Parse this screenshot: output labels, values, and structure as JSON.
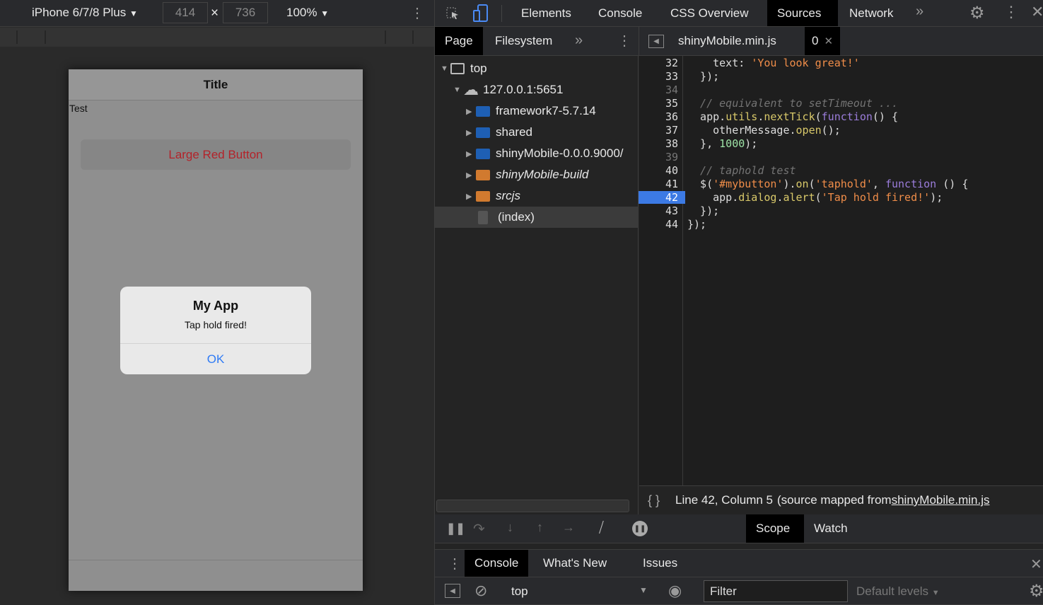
{
  "device_toolbar": {
    "device": "iPhone 6/7/8 Plus",
    "width": "414",
    "height": "736",
    "times": "×",
    "zoom": "100%"
  },
  "phone": {
    "navbar_title": "Title",
    "body_text": "Test",
    "button_label": "Large Red Button",
    "dialog": {
      "title": "My App",
      "message": "Tap hold fired!",
      "ok_label": "OK"
    }
  },
  "devtools": {
    "tabs": [
      "Elements",
      "Console",
      "CSS Overview",
      "Sources",
      "Network"
    ],
    "selected_tab": "Sources",
    "navigator_tabs": [
      "Page",
      "Filesystem"
    ],
    "tree": [
      {
        "label": "top",
        "type": "frame",
        "depth": 0,
        "expanded": true
      },
      {
        "label": "127.0.0.1:5651",
        "type": "cloud",
        "depth": 1,
        "expanded": true
      },
      {
        "label": "framework7-5.7.14",
        "type": "folder",
        "color": "#1e5fb4",
        "depth": 2
      },
      {
        "label": "shared",
        "type": "folder",
        "color": "#1e5fb4",
        "depth": 2
      },
      {
        "label": "shinyMobile-0.0.0.9000/",
        "type": "folder",
        "color": "#1e5fb4",
        "depth": 2
      },
      {
        "label": "shinyMobile-build",
        "type": "folder",
        "color": "#d17a2f",
        "depth": 2,
        "italic": true
      },
      {
        "label": "srcjs",
        "type": "folder",
        "color": "#d17a2f",
        "depth": 2,
        "italic": true
      },
      {
        "label": "(index)",
        "type": "file",
        "depth": 2,
        "selected": true
      }
    ],
    "editor_tabs": [
      {
        "label": "shinyMobile.min.js"
      },
      {
        "label": "0",
        "selected": true
      }
    ],
    "code_lines": [
      {
        "n": "32",
        "t": [
          [
            "    text: ",
            ""
          ],
          [
            "'You look great!'",
            "str"
          ]
        ]
      },
      {
        "n": "33",
        "t": [
          [
            "  });",
            ""
          ]
        ]
      },
      {
        "n": "34",
        "t": []
      },
      {
        "n": "35",
        "t": [
          [
            "  // equivalent to setTimeout ...",
            "cm"
          ]
        ]
      },
      {
        "n": "36",
        "t": [
          [
            "  app.",
            ""
          ],
          [
            "utils",
            "fn"
          ],
          [
            ".",
            ""
          ],
          [
            "nextTick",
            "fn"
          ],
          [
            "(",
            ""
          ],
          [
            "function",
            "kw"
          ],
          [
            "() {",
            ""
          ]
        ]
      },
      {
        "n": "37",
        "t": [
          [
            "    otherMessage.",
            ""
          ],
          [
            "open",
            "fn"
          ],
          [
            "();",
            ""
          ]
        ]
      },
      {
        "n": "38",
        "t": [
          [
            "  }, ",
            ""
          ],
          [
            "1000",
            "num"
          ],
          [
            ");",
            ""
          ]
        ]
      },
      {
        "n": "39",
        "t": []
      },
      {
        "n": "40",
        "t": [
          [
            "  // taphold test",
            "cm"
          ]
        ]
      },
      {
        "n": "41",
        "t": [
          [
            "  $(",
            ""
          ],
          [
            "'#mybutton'",
            "str"
          ],
          [
            ").",
            ""
          ],
          [
            "on",
            "fn"
          ],
          [
            "(",
            ""
          ],
          [
            "'taphold'",
            "str"
          ],
          [
            ", ",
            ""
          ],
          [
            "function",
            "kw"
          ],
          [
            " () {",
            ""
          ]
        ]
      },
      {
        "n": "42",
        "t": [
          [
            "    app.",
            ""
          ],
          [
            "dialog",
            "fn"
          ],
          [
            ".",
            ""
          ],
          [
            "alert",
            "fn"
          ],
          [
            "(",
            ""
          ],
          [
            "'Tap hold fired!'",
            "str"
          ],
          [
            ");",
            ""
          ]
        ],
        "breakpoint": true
      },
      {
        "n": "43",
        "t": [
          [
            "  });",
            ""
          ]
        ]
      },
      {
        "n": "44",
        "t": [
          [
            "});",
            ""
          ]
        ]
      }
    ],
    "status": {
      "pretty_print": "{ }",
      "position": "Line 42, Column 5",
      "source_prefix": "(source mapped from ",
      "source_link": "shinyMobile.min.js"
    },
    "sidebar_tabs": [
      "Scope",
      "Watch"
    ],
    "selected_sidebar_tab": "Scope",
    "drawer_tabs": [
      "Console",
      "What's New",
      "Issues"
    ],
    "selected_drawer_tab": "Console",
    "console": {
      "context": "top",
      "filter_placeholder": "Filter",
      "levels": "Default levels"
    }
  }
}
